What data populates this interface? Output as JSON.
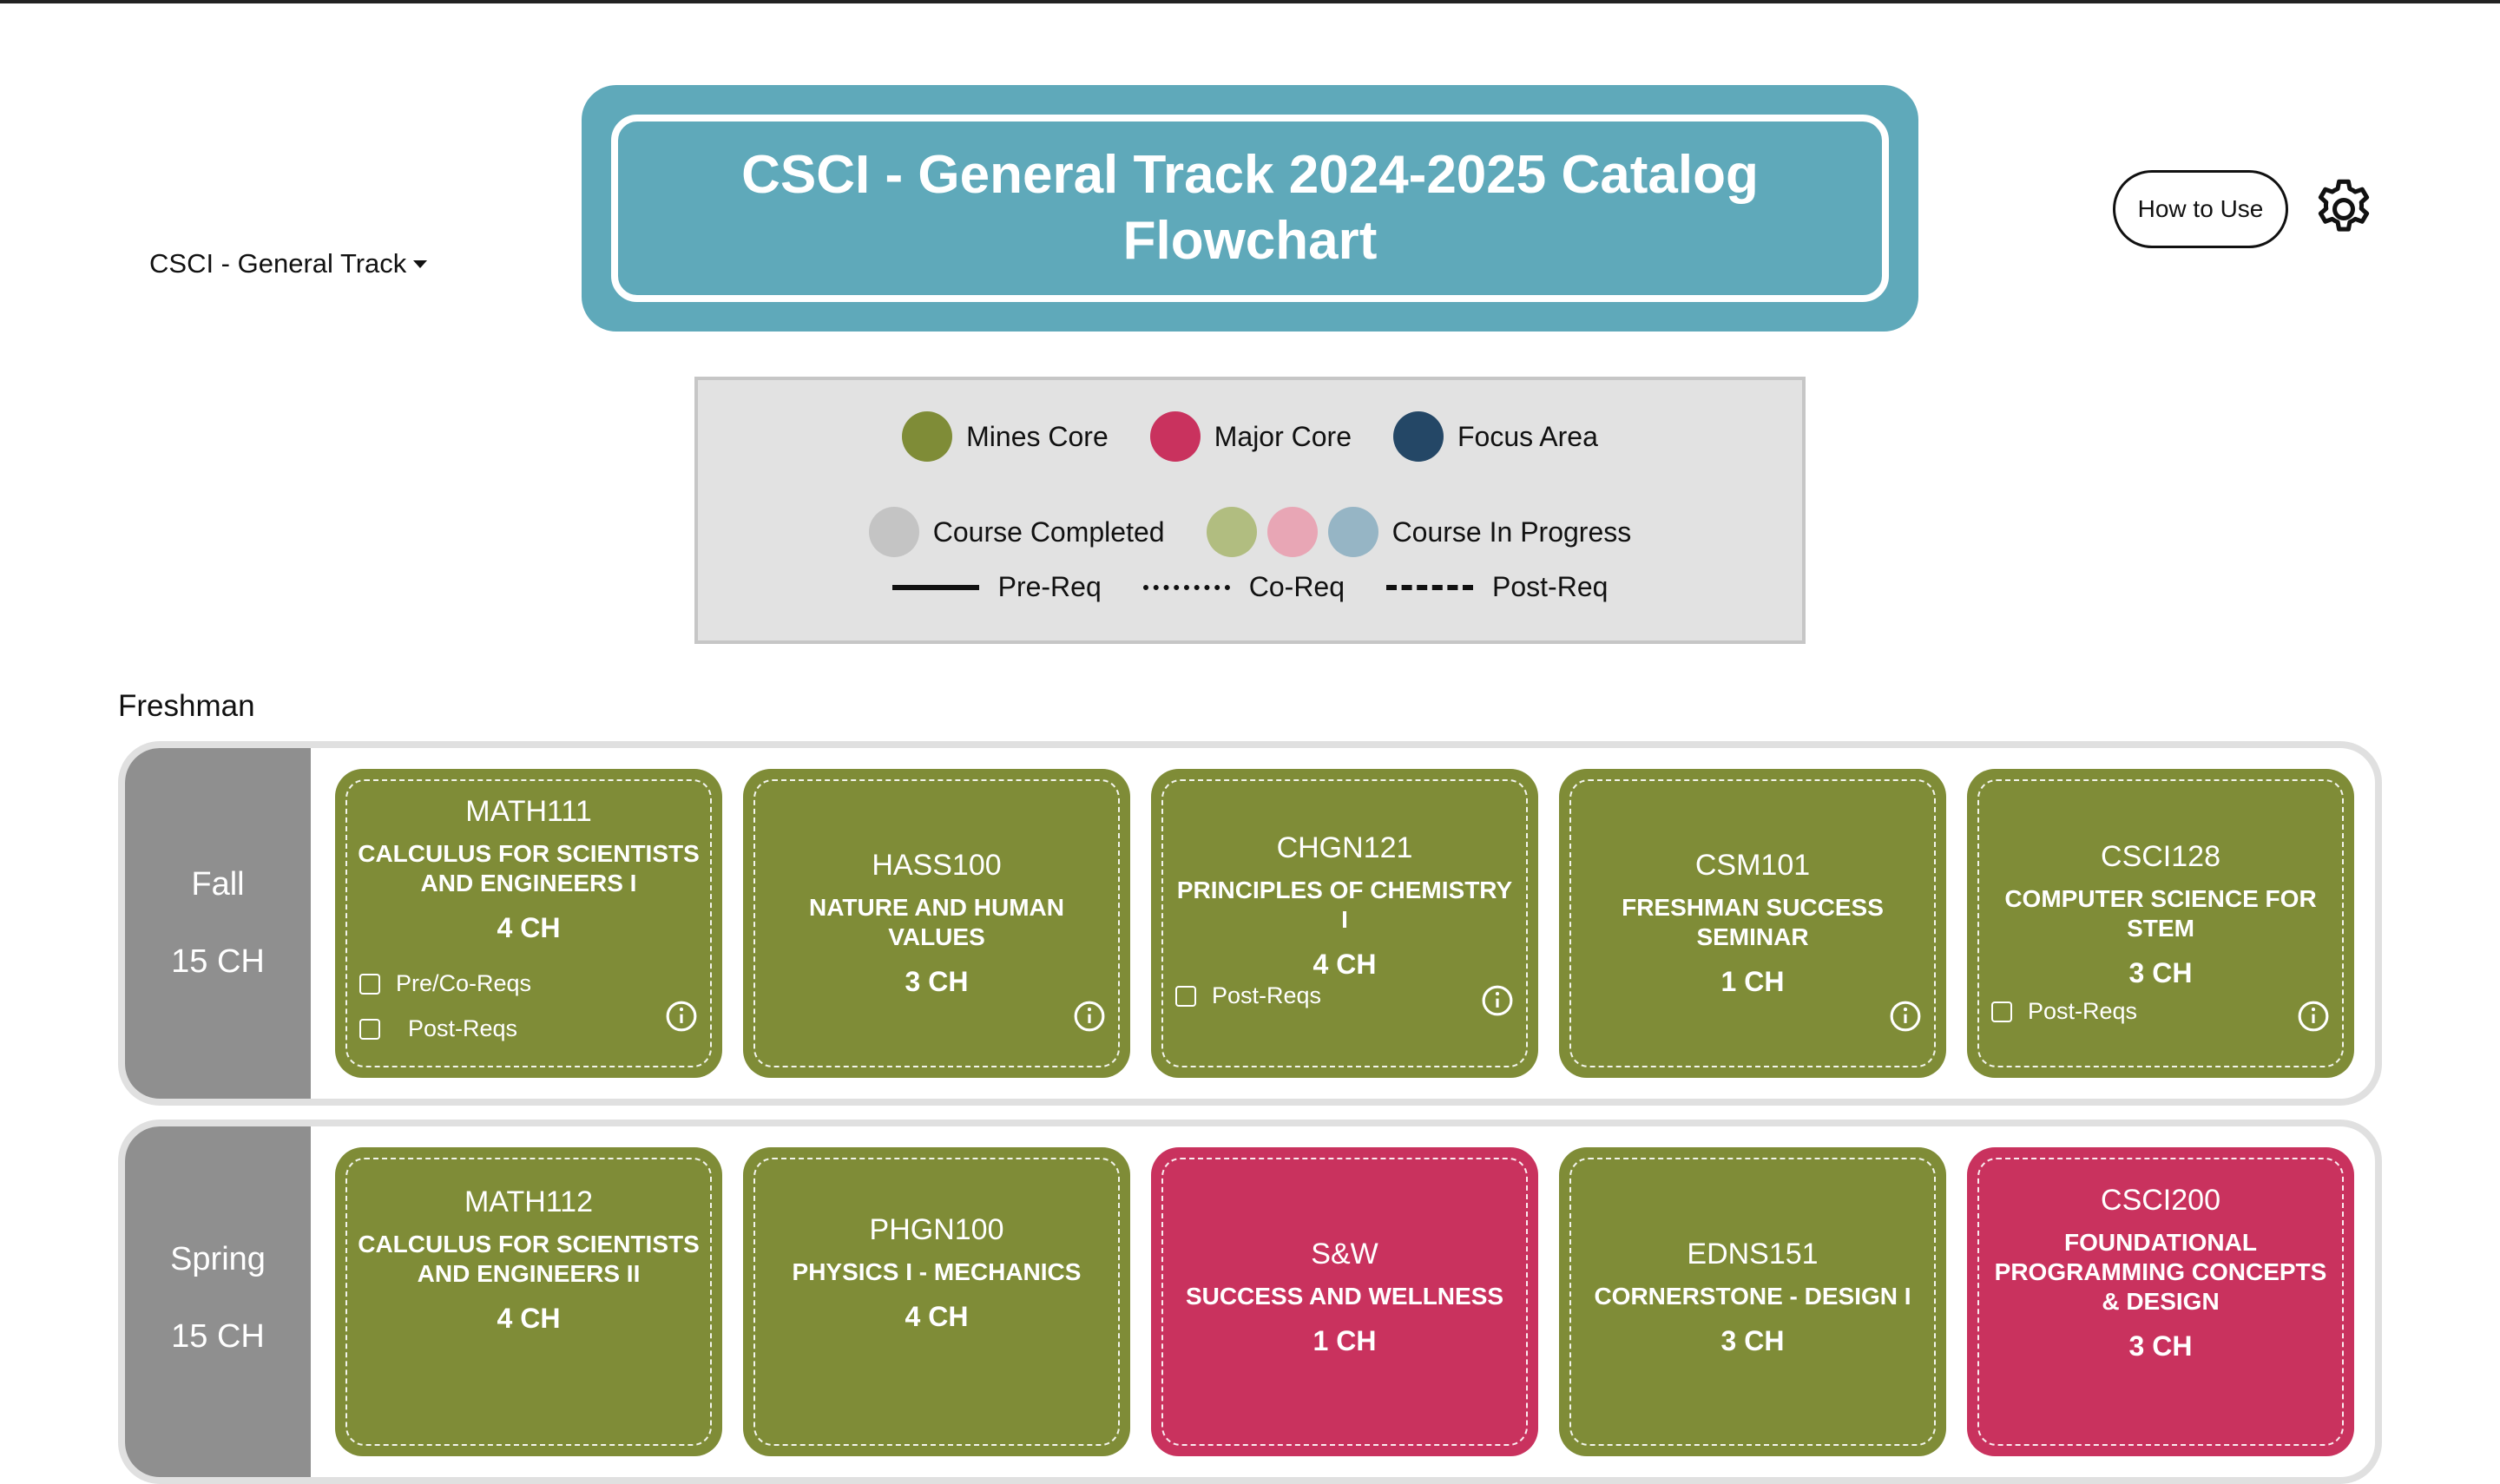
{
  "track_select": {
    "label": "CSCI - General Track"
  },
  "title": "CSCI - General Track 2024-2025 Catalog Flowchart",
  "header": {
    "how_to_use": "How to Use"
  },
  "legend": {
    "row1": [
      {
        "label": "Mines Core",
        "color": "#7f8c37"
      },
      {
        "label": "Major Core",
        "color": "#c9325e"
      },
      {
        "label": "Focus Area",
        "color": "#244766"
      }
    ],
    "completed": {
      "label": "Course Completed",
      "color": "#c4c4c4"
    },
    "in_progress": {
      "label": "Course In Progress",
      "colors": [
        "#b1bd80",
        "#e8a6b5",
        "#96b5c5"
      ]
    },
    "lines": [
      {
        "label": "Pre-Req",
        "style": "solid"
      },
      {
        "label": "Co-Req",
        "style": "dotted"
      },
      {
        "label": "Post-Req",
        "style": "dashed"
      }
    ]
  },
  "year": "Freshman",
  "semesters": [
    {
      "name": "Fall",
      "credits": "15 CH",
      "courses": [
        {
          "code": "MATH111",
          "name": "CALCULUS FOR SCIENTISTS AND ENGINEERS I",
          "ch": "4 CH",
          "color": "green",
          "checks": [
            "Pre/Co-Reqs",
            "Post-Reqs"
          ]
        },
        {
          "code": "HASS100",
          "name": "NATURE AND HUMAN VALUES",
          "ch": "3 CH",
          "color": "green",
          "checks": []
        },
        {
          "code": "CHGN121",
          "name": "PRINCIPLES OF CHEMISTRY I",
          "ch": "4 CH",
          "color": "green",
          "checks": [
            "Post-Reqs"
          ]
        },
        {
          "code": "CSM101",
          "name": "FRESHMAN SUCCESS SEMINAR",
          "ch": "1 CH",
          "color": "green",
          "checks": []
        },
        {
          "code": "CSCI128",
          "name": "COMPUTER SCIENCE FOR STEM",
          "ch": "3 CH",
          "color": "green",
          "checks": [
            "Post-Reqs"
          ]
        }
      ]
    },
    {
      "name": "Spring",
      "credits": "15 CH",
      "courses": [
        {
          "code": "MATH112",
          "name": "CALCULUS FOR SCIENTISTS AND ENGINEERS II",
          "ch": "4 CH",
          "color": "green"
        },
        {
          "code": "PHGN100",
          "name": "PHYSICS I - MECHANICS",
          "ch": "4 CH",
          "color": "green"
        },
        {
          "code": "S&W",
          "name": "SUCCESS AND WELLNESS",
          "ch": "1 CH",
          "color": "pink"
        },
        {
          "code": "EDNS151",
          "name": "CORNERSTONE - DESIGN I",
          "ch": "3 CH",
          "color": "green"
        },
        {
          "code": "CSCI200",
          "name": "FOUNDATIONAL PROGRAMMING CONCEPTS & DESIGN",
          "ch": "3 CH",
          "color": "pink"
        }
      ]
    }
  ]
}
